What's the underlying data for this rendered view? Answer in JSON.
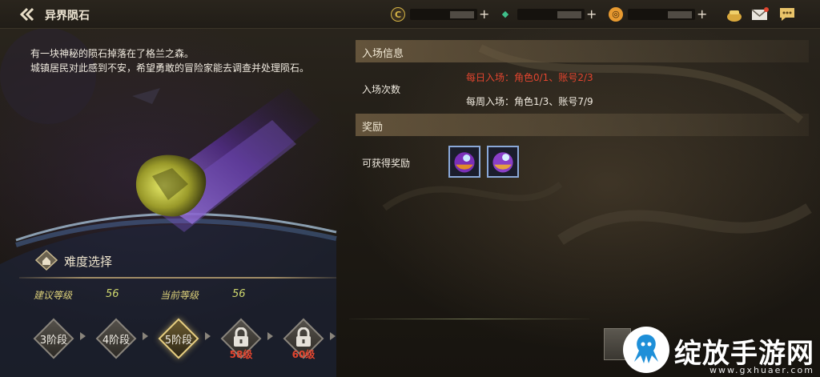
{
  "header": {
    "title": "异界陨石",
    "currencies": [
      {
        "icon": "gold-coin-icon",
        "symbol": "C",
        "color": "#d7b545"
      },
      {
        "icon": "green-crystal-icon",
        "symbol": "◆",
        "color": "#3fbf8a"
      },
      {
        "icon": "orange-coin-icon",
        "symbol": "◎",
        "color": "#e89a30"
      }
    ],
    "icons": [
      "treasure-pot-icon",
      "mail-icon",
      "chat-icon"
    ]
  },
  "description": {
    "line1": "有一块神秘的陨石掉落在了格兰之森。",
    "line2": "城镇居民对此感到不安，希望勇敢的冒险家能去调查并处理陨石。"
  },
  "difficulty": {
    "title": "难度选择",
    "recommended_label": "建议等级",
    "recommended_value": "56",
    "current_label": "当前等级",
    "current_value": "56",
    "stages": [
      {
        "label": "3阶段",
        "locked": false,
        "active": false
      },
      {
        "label": "4阶段",
        "locked": false,
        "active": false
      },
      {
        "label": "5阶段",
        "locked": false,
        "active": true
      },
      {
        "label": "",
        "locked": true,
        "req": "58级"
      },
      {
        "label": "",
        "locked": true,
        "req": "60级"
      }
    ]
  },
  "entry_info": {
    "header": "入场信息",
    "count_label": "入场次数",
    "daily": "每日入场：角色0/1、账号2/3",
    "weekly": "每周入场：角色1/3、账号7/9"
  },
  "rewards": {
    "header": "奖励",
    "label": "可获得奖励"
  },
  "watermark": {
    "text": "绽放手游网",
    "url": "www.gxhuaer.com"
  },
  "colors": {
    "warning_red": "#e2452f",
    "accent_gold": "#e8cf80",
    "level_yellow": "#cfd86e"
  }
}
